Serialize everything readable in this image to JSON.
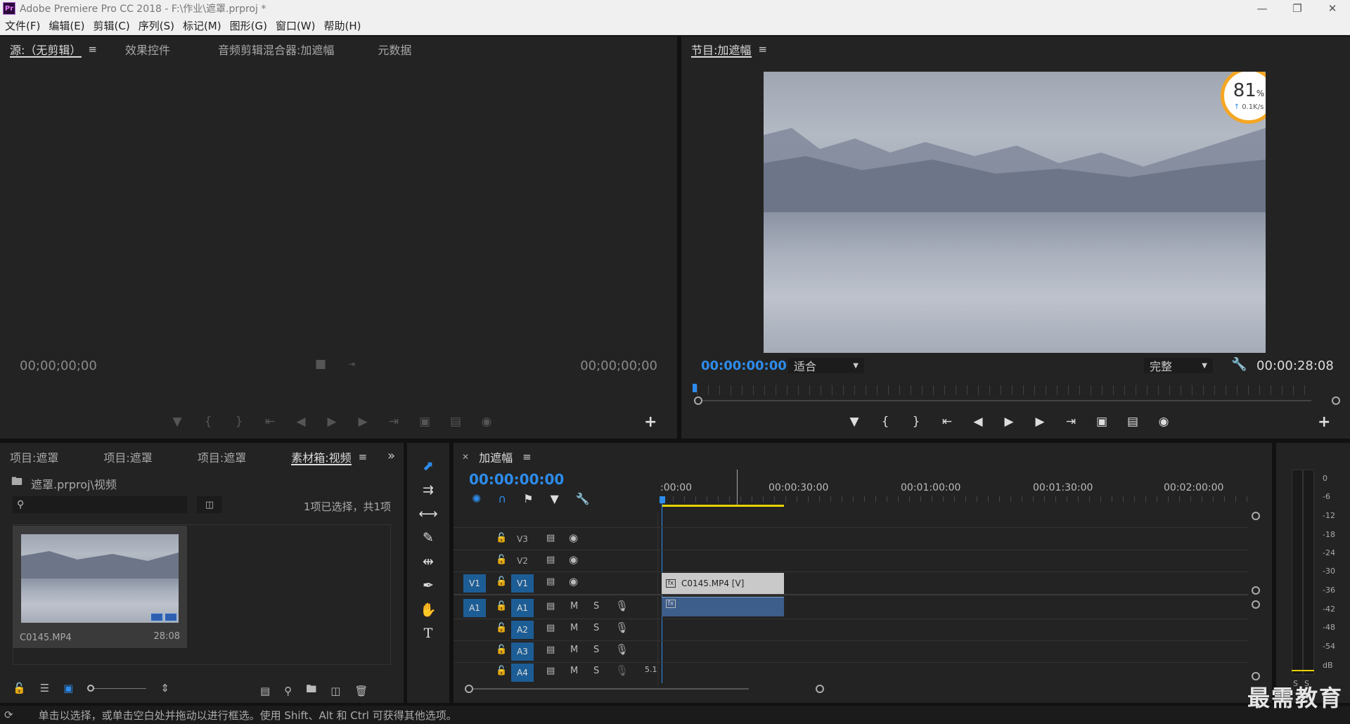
{
  "window": {
    "title": "Adobe Premiere Pro CC 2018 - F:\\作业\\遮罩.prproj *",
    "logo": "Pr",
    "controls": [
      "minimize-icon",
      "restore-icon",
      "close-icon"
    ]
  },
  "menu": [
    "文件(F)",
    "编辑(E)",
    "剪辑(C)",
    "序列(S)",
    "标记(M)",
    "图形(G)",
    "窗口(W)",
    "帮助(H)"
  ],
  "source_panel": {
    "tabs": [
      "源:（无剪辑）",
      "效果控件",
      "音频剪辑混合器:加遮幅",
      "元数据"
    ],
    "timecode_left": "00;00;00;00",
    "timecode_right": "00;00;00;00"
  },
  "program_panel": {
    "tab": "节目:加遮幅",
    "timecode_current": "00:00:00:00",
    "zoom": "适合",
    "quality": "完整",
    "duration": "00:00:28:08",
    "overlay_badge": {
      "percent": "81",
      "percent_unit": "%",
      "speed": "0.1K/s"
    }
  },
  "project_panel": {
    "tabs": [
      "项目:遮罩",
      "项目:遮罩",
      "项目:遮罩",
      "素材箱:视频"
    ],
    "path": "遮罩.prproj\\视频",
    "search_placeholder": "",
    "selection_info": "1项已选择，共1项",
    "clip": {
      "name": "C0145.MP4",
      "duration": "28:08"
    }
  },
  "timeline": {
    "tab": "加遮幅",
    "timecode": "00:00:00:00",
    "ruler": [
      ":00:00",
      "00:00:30:00",
      "00:01:00:00",
      "00:01:30:00",
      "00:02:00:00"
    ],
    "video_tracks": [
      "V3",
      "V2",
      "V1"
    ],
    "audio_tracks": [
      "A1",
      "A2",
      "A3",
      "A4"
    ],
    "source_v": "V1",
    "source_a": "A1",
    "track_m": "M",
    "track_s": "S",
    "a4_extra": "5.1",
    "video_clip": {
      "name": "C0145.MP4 [V]",
      "fx": "fx"
    },
    "audio_clip": {
      "fx": "fx"
    }
  },
  "meter": {
    "scale": [
      "0",
      "-6",
      "-12",
      "-18",
      "-24",
      "-30",
      "-36",
      "-42",
      "-48",
      "-54",
      "dB"
    ],
    "solo": [
      "S",
      "S"
    ]
  },
  "status": "单击以选择，或单击空白处并拖动以进行框选。使用 Shift、Alt 和 Ctrl 可获得其他选项。",
  "watermark": "最需教育",
  "colors": {
    "accent": "#2d8ceb",
    "track_target": "#1d5d95",
    "badge_ring": "#f5a623",
    "work_area": "#e6d300"
  }
}
